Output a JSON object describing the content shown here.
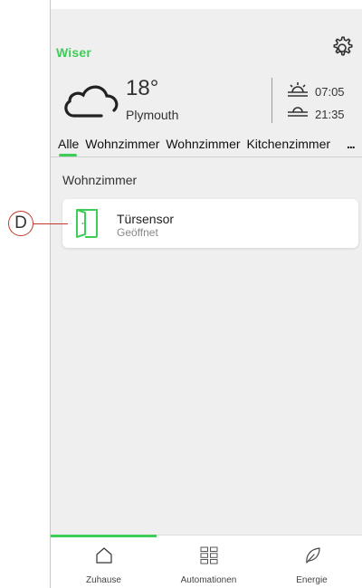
{
  "header": {
    "logo_text": "Wiser",
    "settings_icon": "gear-icon"
  },
  "weather": {
    "icon": "cloud-icon",
    "temperature": "18°",
    "city": "Plymouth",
    "sunrise_icon": "sunrise-icon",
    "sunrise_time": "07:05",
    "sunset_icon": "sunset-icon",
    "sunset_time": "21:35"
  },
  "room_tabs": {
    "items": [
      "Alle",
      "Wohnzimmer",
      "Wohnzimmer",
      "Kitchenzimmer"
    ],
    "active_index": 0,
    "more_label": "..."
  },
  "main": {
    "section_title": "Wohnzimmer",
    "devices": [
      {
        "icon": "door-open-icon",
        "name": "Türsensor",
        "status": "Geöffnet"
      }
    ]
  },
  "callout": {
    "label": "D"
  },
  "bottom_nav": {
    "items": [
      {
        "label": "Zuhause",
        "icon": "home-icon",
        "active": true
      },
      {
        "label": "Automationen",
        "icon": "grid-icon",
        "active": false
      },
      {
        "label": "Energie",
        "icon": "leaf-icon",
        "active": false
      }
    ]
  },
  "colors": {
    "accent": "#3dcd58",
    "background": "#efefef",
    "callout": "#c0392b"
  }
}
